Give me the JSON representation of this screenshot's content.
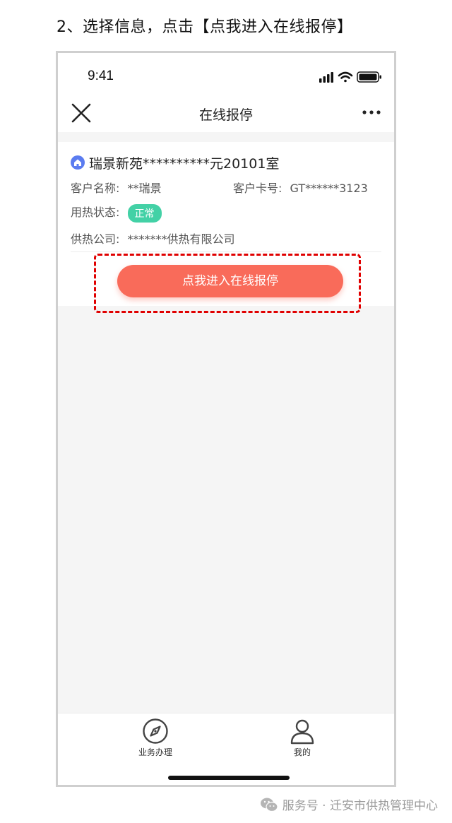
{
  "instruction": "2、选择信息，点击【点我进入在线报停】",
  "status_bar": {
    "time": "9:41"
  },
  "nav": {
    "title": "在线报停"
  },
  "card": {
    "title": "瑞景新苑**********元20101室",
    "customer_name_label": "客户名称:",
    "customer_name": "**瑞景",
    "customer_card_label": "客户卡号:",
    "customer_card": "GT******3123",
    "heating_status_label": "用热状态:",
    "heating_status": "正常",
    "company_label": "供热公司:",
    "company": "*******供热有限公司"
  },
  "action_button": "点我进入在线报停",
  "tabs": [
    {
      "label": "业务办理",
      "icon": "compass-icon"
    },
    {
      "label": "我的",
      "icon": "person-icon"
    }
  ],
  "footer": "服务号 · 迁安市供热管理中心",
  "colors": {
    "accent_button": "#f96b5a",
    "status_badge": "#43d1a6",
    "home_icon": "#5b7cf0",
    "highlight": "#e00000"
  }
}
